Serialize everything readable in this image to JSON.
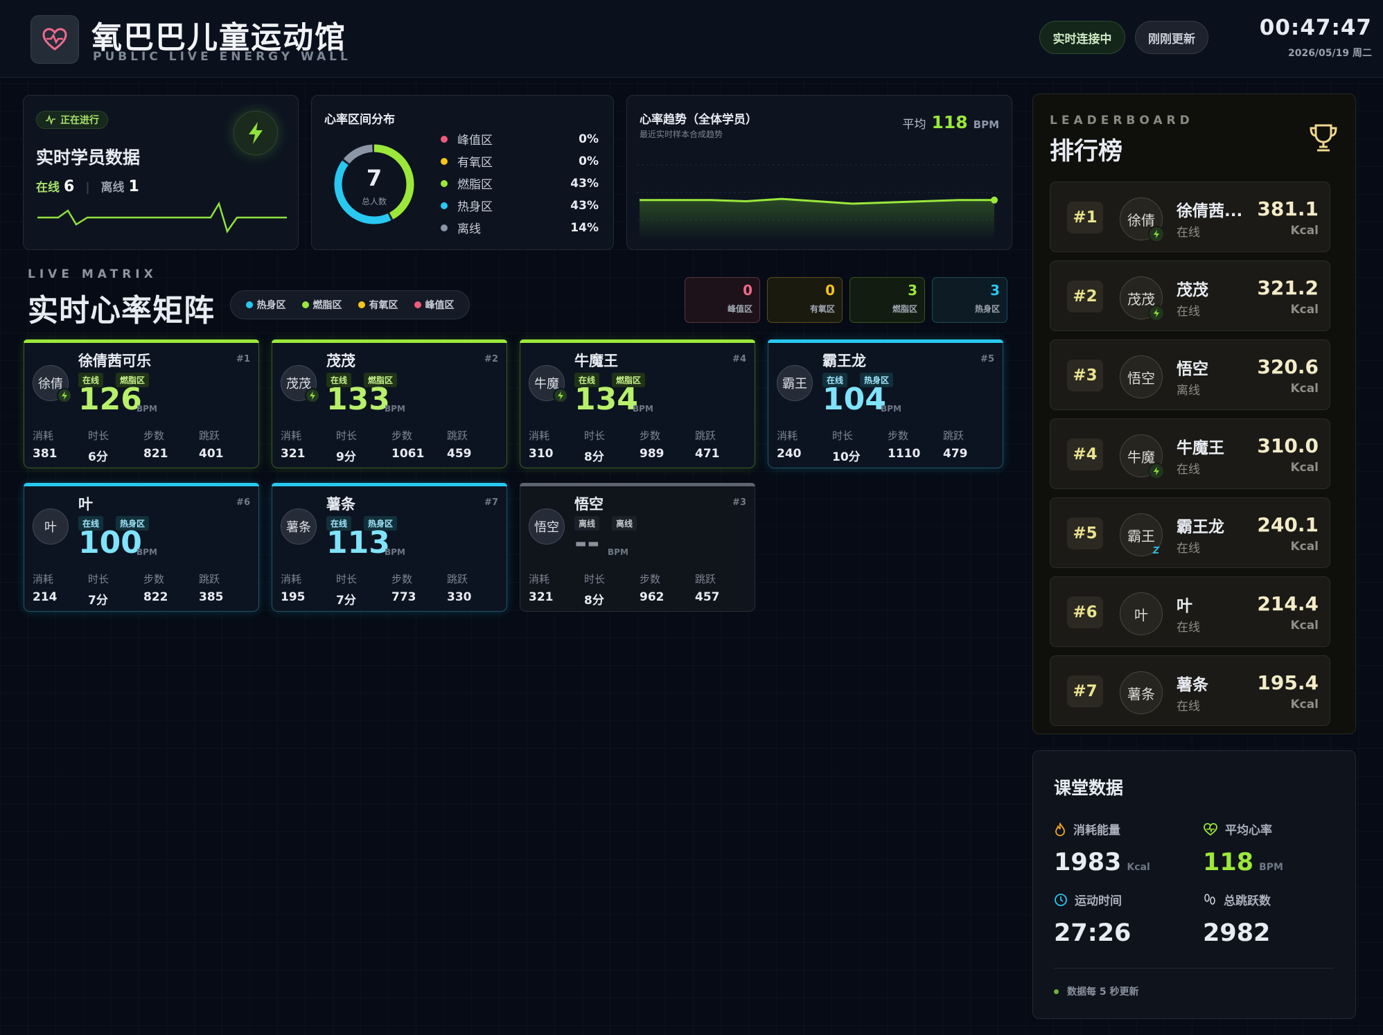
{
  "header": {
    "title": "氧巴巴儿童运动馆",
    "subtitle": "PUBLIC LIVE ENERGY WALL",
    "status_live": "实时连接中",
    "status_update": "刚刚更新",
    "clock": "00:47:47",
    "date": "2026/05/19 周二",
    "logo_icon": "heart-pulse-icon"
  },
  "live_panel": {
    "badge": "正在进行",
    "title": "实时学员数据",
    "online_label": "在线",
    "online_count": "6",
    "offline_label": "离线",
    "offline_count": "1"
  },
  "zone_panel": {
    "title": "心率区间分布",
    "total": "7",
    "total_label": "总人数",
    "zones": [
      {
        "name": "峰值区",
        "pct": "0%",
        "color": "#f05a7a",
        "value": 0
      },
      {
        "name": "有氧区",
        "pct": "0%",
        "color": "#f5c518",
        "value": 0
      },
      {
        "name": "燃脂区",
        "pct": "43%",
        "color": "#9be83a",
        "value": 43
      },
      {
        "name": "热身区",
        "pct": "43%",
        "color": "#28c8f0",
        "value": 43
      },
      {
        "name": "离线",
        "pct": "14%",
        "color": "#8d96a6",
        "value": 14
      }
    ]
  },
  "trend_panel": {
    "title": "心率趋势（全体学员）",
    "subtitle": "最近实时样本合成趋势",
    "avg_label": "平均",
    "avg_value": "118",
    "avg_unit": "BPM"
  },
  "chart_data": {
    "type": "area",
    "values": [
      118,
      118,
      118,
      117,
      119,
      117,
      115,
      116,
      117,
      118,
      118
    ]
  },
  "matrix": {
    "caption": "LIVE MATRIX",
    "title": "实时心率矩阵",
    "legend": [
      {
        "label": "热身区",
        "color": "#28c8f0"
      },
      {
        "label": "燃脂区",
        "color": "#9be83a"
      },
      {
        "label": "有氧区",
        "color": "#f5c518"
      },
      {
        "label": "峰值区",
        "color": "#f05a7a"
      }
    ],
    "zone_counts": [
      {
        "count": "0",
        "label": "峰值区",
        "color": "#f06a8a",
        "border": "#5a3442",
        "bg": "#1d1219"
      },
      {
        "count": "0",
        "label": "有氧区",
        "color": "#f5c518",
        "border": "#5b4d1d",
        "bg": "#1b1a0f"
      },
      {
        "count": "3",
        "label": "燃脂区",
        "color": "#9be83a",
        "border": "#3a5524",
        "bg": "#121c10"
      },
      {
        "count": "3",
        "label": "热身区",
        "color": "#28c8f0",
        "border": "#1e4c5e",
        "bg": "#0d1b24"
      }
    ],
    "stat_labels": [
      "消耗",
      "时长",
      "步数",
      "跳跃"
    ],
    "bpm_unit": "BPM",
    "cards": [
      {
        "name": "徐倩茜可乐",
        "avatar": "徐倩",
        "no": "#1",
        "status": "在线",
        "zone": "燃脂区",
        "bpm": "126",
        "theme": "green",
        "stats": [
          "381",
          "6分",
          "821",
          "401"
        ]
      },
      {
        "name": "茂茂",
        "avatar": "茂茂",
        "no": "#2",
        "status": "在线",
        "zone": "燃脂区",
        "bpm": "133",
        "theme": "green",
        "stats": [
          "321",
          "9分",
          "1061",
          "459"
        ]
      },
      {
        "name": "牛魔王",
        "avatar": "牛魔",
        "no": "#4",
        "status": "在线",
        "zone": "燃脂区",
        "bpm": "134",
        "theme": "green",
        "stats": [
          "310",
          "8分",
          "989",
          "471"
        ]
      },
      {
        "name": "霸王龙",
        "avatar": "霸王",
        "no": "#5",
        "status": "在线",
        "zone": "热身区",
        "bpm": "104",
        "theme": "blue",
        "stats": [
          "240",
          "10分",
          "1110",
          "479"
        ]
      },
      {
        "name": "叶",
        "avatar": "叶",
        "no": "#6",
        "status": "在线",
        "zone": "热身区",
        "bpm": "100",
        "theme": "blue",
        "stats": [
          "214",
          "7分",
          "822",
          "385"
        ]
      },
      {
        "name": "薯条",
        "avatar": "薯条",
        "no": "#7",
        "status": "在线",
        "zone": "热身区",
        "bpm": "113",
        "theme": "blue",
        "stats": [
          "195",
          "7分",
          "773",
          "330"
        ]
      },
      {
        "name": "悟空",
        "avatar": "悟空",
        "no": "#3",
        "status": "离线",
        "zone": "离线",
        "bpm": "--",
        "theme": "gray",
        "stats": [
          "321",
          "8分",
          "962",
          "457"
        ]
      }
    ]
  },
  "leaderboard": {
    "caption": "LEADERBOARD",
    "title": "排行榜",
    "unit": "Kcal",
    "rows": [
      {
        "rank": "#1",
        "avatar": "徐倩",
        "name": "徐倩茜...",
        "status": "在线",
        "kcal": "381.1",
        "badge": "bolt"
      },
      {
        "rank": "#2",
        "avatar": "茂茂",
        "name": "茂茂",
        "status": "在线",
        "kcal": "321.2",
        "badge": "bolt"
      },
      {
        "rank": "#3",
        "avatar": "悟空",
        "name": "悟空",
        "status": "离线",
        "kcal": "320.6",
        "badge": "none"
      },
      {
        "rank": "#4",
        "avatar": "牛魔",
        "name": "牛魔王",
        "status": "在线",
        "kcal": "310.0",
        "badge": "bolt"
      },
      {
        "rank": "#5",
        "avatar": "霸王",
        "name": "霸王龙",
        "status": "在线",
        "kcal": "240.1",
        "badge": "sleep"
      },
      {
        "rank": "#6",
        "avatar": "叶",
        "name": "叶",
        "status": "在线",
        "kcal": "214.4",
        "badge": "none"
      },
      {
        "rank": "#7",
        "avatar": "薯条",
        "name": "薯条",
        "status": "在线",
        "kcal": "195.4",
        "badge": "none"
      }
    ]
  },
  "class_data": {
    "title": "课堂数据",
    "energy_label": "消耗能量",
    "energy_value": "1983",
    "energy_unit": "Kcal",
    "avg_hr_label": "平均心率",
    "avg_hr_value": "118",
    "avg_hr_unit": "BPM",
    "time_label": "运动时间",
    "time_value": "27:26",
    "jumps_label": "总跳跃数",
    "jumps_value": "2982",
    "footer": "数据每 5 秒更新"
  }
}
